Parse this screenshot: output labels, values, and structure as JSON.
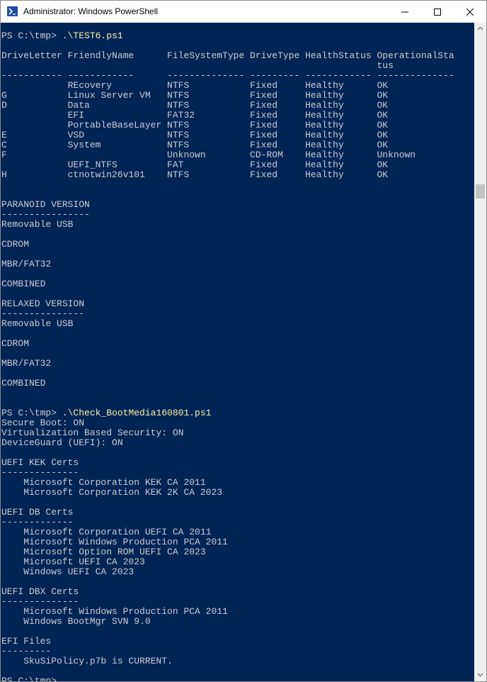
{
  "window": {
    "title": "Administrator: Windows PowerShell",
    "icon": "powershell-icon",
    "console_bg": "#012456",
    "console_fg": "#cccccc",
    "command_color": "#f9f1a5"
  },
  "console": {
    "lines": [
      {
        "prompt": "PS C:\\tmp> ",
        "command": ".\\TEST6.ps1"
      },
      {
        "text": ""
      },
      {
        "text": "DriveLetter FriendlyName      FileSystemType DriveType HealthStatus OperationalSta"
      },
      {
        "text": "                                                                    tus"
      },
      {
        "text": "----------- ------------      -------------- --------- ------------ --------------"
      },
      {
        "text": "            REcovery          NTFS           Fixed     Healthy      OK"
      },
      {
        "text": "G           Linux Server VM   NTFS           Fixed     Healthy      OK"
      },
      {
        "text": "D           Data              NTFS           Fixed     Healthy      OK"
      },
      {
        "text": "            EFI               FAT32          Fixed     Healthy      OK"
      },
      {
        "text": "            PortableBaseLayer NTFS           Fixed     Healthy      OK"
      },
      {
        "text": "E           VSD               NTFS           Fixed     Healthy      OK"
      },
      {
        "text": "C           System            NTFS           Fixed     Healthy      OK"
      },
      {
        "text": "F                             Unknown        CD-ROM    Healthy      Unknown"
      },
      {
        "text": "            UEFI_NTFS         FAT            Fixed     Healthy      OK"
      },
      {
        "text": "H           ctnotwin26v101    NTFS           Fixed     Healthy      OK"
      },
      {
        "text": ""
      },
      {
        "text": ""
      },
      {
        "text": "PARANOID VERSION"
      },
      {
        "text": "----------------"
      },
      {
        "text": "Removable USB"
      },
      {
        "text": ""
      },
      {
        "text": "CDROM"
      },
      {
        "text": ""
      },
      {
        "text": "MBR/FAT32"
      },
      {
        "text": ""
      },
      {
        "text": "COMBINED"
      },
      {
        "text": ""
      },
      {
        "text": "RELAXED VERSION"
      },
      {
        "text": "---------------"
      },
      {
        "text": "Removable USB"
      },
      {
        "text": ""
      },
      {
        "text": "CDROM"
      },
      {
        "text": ""
      },
      {
        "text": "MBR/FAT32"
      },
      {
        "text": ""
      },
      {
        "text": "COMBINED"
      },
      {
        "text": ""
      },
      {
        "text": ""
      },
      {
        "prompt": "PS C:\\tmp> ",
        "command": ".\\Check_BootMedia160801.ps1"
      },
      {
        "text": "Secure Boot: ON"
      },
      {
        "text": "Virtualization Based Security: ON"
      },
      {
        "text": "DeviceGuard (UEFI): ON"
      },
      {
        "text": ""
      },
      {
        "text": "UEFI KEK Certs"
      },
      {
        "text": "--------------"
      },
      {
        "text": "    Microsoft Corporation KEK CA 2011"
      },
      {
        "text": "    Microsoft Corporation KEK 2K CA 2023"
      },
      {
        "text": ""
      },
      {
        "text": "UEFI DB Certs"
      },
      {
        "text": "-------------"
      },
      {
        "text": "    Microsoft Corporation UEFI CA 2011"
      },
      {
        "text": "    Microsoft Windows Production PCA 2011"
      },
      {
        "text": "    Microsoft Option ROM UEFI CA 2023"
      },
      {
        "text": "    Microsoft UEFI CA 2023"
      },
      {
        "text": "    Windows UEFI CA 2023"
      },
      {
        "text": ""
      },
      {
        "text": "UEFI DBX Certs"
      },
      {
        "text": "--------------"
      },
      {
        "text": "    Microsoft Windows Production PCA 2011"
      },
      {
        "text": "    Windows BootMgr SVN 9.0"
      },
      {
        "text": ""
      },
      {
        "text": "EFI Files"
      },
      {
        "text": "---------"
      },
      {
        "text": "    SkuSiPolicy.p7b is CURRENT."
      },
      {
        "text": ""
      },
      {
        "prompt": "PS C:\\tmp> ",
        "command": ""
      }
    ]
  }
}
